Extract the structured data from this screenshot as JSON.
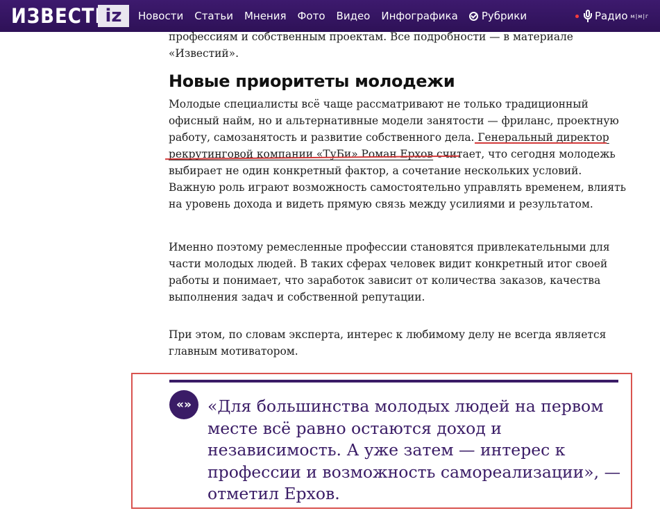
{
  "header": {
    "logo_text": "ИЗВЕСТИЯ",
    "logo_badge": "iz",
    "nav": [
      "Новости",
      "Статьи",
      "Мнения",
      "Фото",
      "Видео",
      "Инфографика"
    ],
    "rubrics_label": "Рубрики",
    "radio_label": "Радио",
    "radio_mark": "м|м|г"
  },
  "article": {
    "intro": "профессиям и собственным проектам. Все подробности — в материале «Известий».",
    "subheading": "Новые приоритеты молодежи",
    "p1_before": "Молодые специалисты всё чаще рассматривают не только традиционный офисный найм, но и альтернативные модели занятости — фриланс, проектную работу, самозанятость и развитие собственного дела. ",
    "p1_link": "Генеральный директор рекрутинговой компании «ТуБи» Роман Ерхов",
    "p1_after": " считает, что сегодня молодежь выбирает не один конкретный фактор, а сочетание нескольких условий. Важную роль играют возможность самостоятельно управлять временем, влиять на уровень дохода и видеть прямую связь между усилиями и результатом.",
    "p2": "Именно поэтому ремесленные профессии становятся привлекательными для части молодых людей. В таких сферах человек видит конкретный итог своей работы и понимает, что заработок зависит от количества заказов, качества выполнения задач и собственной репутации.",
    "p3": "При этом, по словам эксперта, интерес к любимому делу не всегда является главным мотиватором."
  },
  "quote": {
    "icon": "«»",
    "text": "«Для большинства молодых людей на первом месте всё равно остаются доход и независимость. А уже затем — интерес к профессии и возможность самореализации», — отметил Ерхов."
  },
  "colors": {
    "header_bg": "#3d1a6e",
    "quote_accent": "#3a1c66",
    "annotation_red": "#d33a3a"
  }
}
